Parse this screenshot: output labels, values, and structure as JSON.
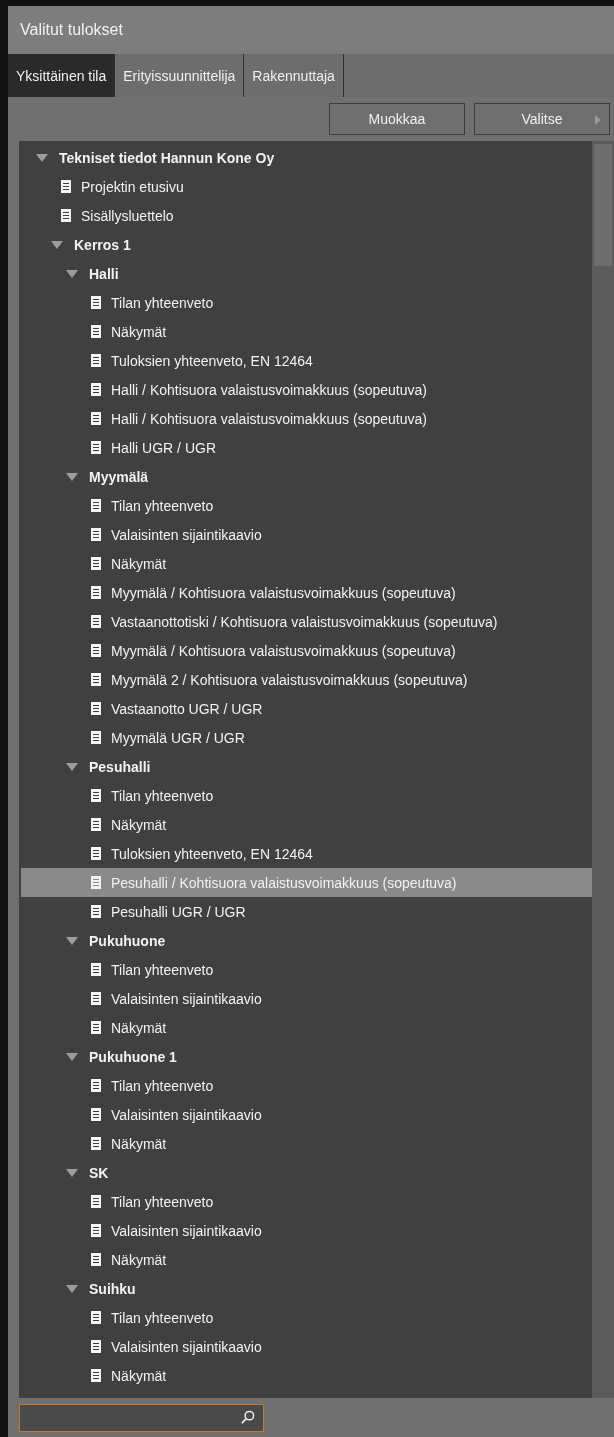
{
  "window": {
    "title": "Valitut tulokset"
  },
  "tabs": [
    {
      "label": "Yksittäinen tila",
      "selected": true
    },
    {
      "label": "Erityissuunnittelija",
      "selected": false
    },
    {
      "label": "Rakennuttaja",
      "selected": false
    }
  ],
  "toolbar": {
    "buttons": [
      {
        "label": "Muokkaa",
        "kind": "plain"
      },
      {
        "label": "Valitse",
        "kind": "menu"
      }
    ]
  },
  "tree": [
    {
      "kind": "folder",
      "label": "Tekniset tiedot Hannun Kone Oy",
      "expanded": true,
      "selected": false,
      "children": [
        {
          "kind": "document",
          "label": "Projektin etusivu",
          "selected": false
        },
        {
          "kind": "document",
          "label": "Sisällysluettelo",
          "selected": false
        },
        {
          "kind": "folder",
          "label": "Kerros 1",
          "expanded": true,
          "selected": false,
          "children": [
            {
              "kind": "folder",
              "label": "Halli",
              "expanded": true,
              "selected": false,
              "children": [
                {
                  "kind": "document",
                  "label": "Tilan yhteenveto",
                  "selected": false
                },
                {
                  "kind": "document",
                  "label": "Näkymät",
                  "selected": false
                },
                {
                  "kind": "document",
                  "label": "Tuloksien yhteenveto, EN 12464",
                  "selected": false
                },
                {
                  "kind": "document",
                  "label": "Halli / Kohtisuora valaistusvoimakkuus (sopeutuva)",
                  "selected": false
                },
                {
                  "kind": "document",
                  "label": "Halli / Kohtisuora valaistusvoimakkuus (sopeutuva)",
                  "selected": false
                },
                {
                  "kind": "document",
                  "label": "Halli UGR / UGR",
                  "selected": false
                }
              ]
            },
            {
              "kind": "folder",
              "label": "Myymälä",
              "expanded": true,
              "selected": false,
              "children": [
                {
                  "kind": "document",
                  "label": "Tilan yhteenveto",
                  "selected": false
                },
                {
                  "kind": "document",
                  "label": "Valaisinten sijaintikaavio",
                  "selected": false
                },
                {
                  "kind": "document",
                  "label": "Näkymät",
                  "selected": false
                },
                {
                  "kind": "document",
                  "label": "Myymälä / Kohtisuora valaistusvoimakkuus (sopeutuva)",
                  "selected": false
                },
                {
                  "kind": "document",
                  "label": "Vastaanottotiski / Kohtisuora valaistusvoimakkuus (sopeutuva)",
                  "selected": false
                },
                {
                  "kind": "document",
                  "label": "Myymälä / Kohtisuora valaistusvoimakkuus (sopeutuva)",
                  "selected": false
                },
                {
                  "kind": "document",
                  "label": "Myymälä 2 / Kohtisuora valaistusvoimakkuus (sopeutuva)",
                  "selected": false
                },
                {
                  "kind": "document",
                  "label": "Vastaanotto UGR / UGR",
                  "selected": false
                },
                {
                  "kind": "document",
                  "label": "Myymälä UGR / UGR",
                  "selected": false
                }
              ]
            },
            {
              "kind": "folder",
              "label": "Pesuhalli",
              "expanded": true,
              "selected": false,
              "children": [
                {
                  "kind": "document",
                  "label": "Tilan yhteenveto",
                  "selected": false
                },
                {
                  "kind": "document",
                  "label": "Näkymät",
                  "selected": false
                },
                {
                  "kind": "document",
                  "label": "Tuloksien yhteenveto, EN 12464",
                  "selected": false
                },
                {
                  "kind": "document",
                  "label": "Pesuhalli / Kohtisuora valaistusvoimakkuus (sopeutuva)",
                  "selected": true
                },
                {
                  "kind": "document",
                  "label": "Pesuhalli UGR / UGR",
                  "selected": false
                }
              ]
            },
            {
              "kind": "folder",
              "label": "Pukuhuone",
              "expanded": true,
              "selected": false,
              "children": [
                {
                  "kind": "document",
                  "label": "Tilan yhteenveto",
                  "selected": false
                },
                {
                  "kind": "document",
                  "label": "Valaisinten sijaintikaavio",
                  "selected": false
                },
                {
                  "kind": "document",
                  "label": "Näkymät",
                  "selected": false
                }
              ]
            },
            {
              "kind": "folder",
              "label": "Pukuhuone 1",
              "expanded": true,
              "selected": false,
              "children": [
                {
                  "kind": "document",
                  "label": "Tilan yhteenveto",
                  "selected": false
                },
                {
                  "kind": "document",
                  "label": "Valaisinten sijaintikaavio",
                  "selected": false
                },
                {
                  "kind": "document",
                  "label": "Näkymät",
                  "selected": false
                }
              ]
            },
            {
              "kind": "folder",
              "label": "SK",
              "expanded": true,
              "selected": false,
              "children": [
                {
                  "kind": "document",
                  "label": "Tilan yhteenveto",
                  "selected": false
                },
                {
                  "kind": "document",
                  "label": "Valaisinten sijaintikaavio",
                  "selected": false
                },
                {
                  "kind": "document",
                  "label": "Näkymät",
                  "selected": false
                }
              ]
            },
            {
              "kind": "folder",
              "label": "Suihku",
              "expanded": true,
              "selected": false,
              "children": [
                {
                  "kind": "document",
                  "label": "Tilan yhteenveto",
                  "selected": false
                },
                {
                  "kind": "document",
                  "label": "Valaisinten sijaintikaavio",
                  "selected": false
                },
                {
                  "kind": "document",
                  "label": "Näkymät",
                  "selected": false
                }
              ]
            }
          ]
        }
      ]
    }
  ]
}
